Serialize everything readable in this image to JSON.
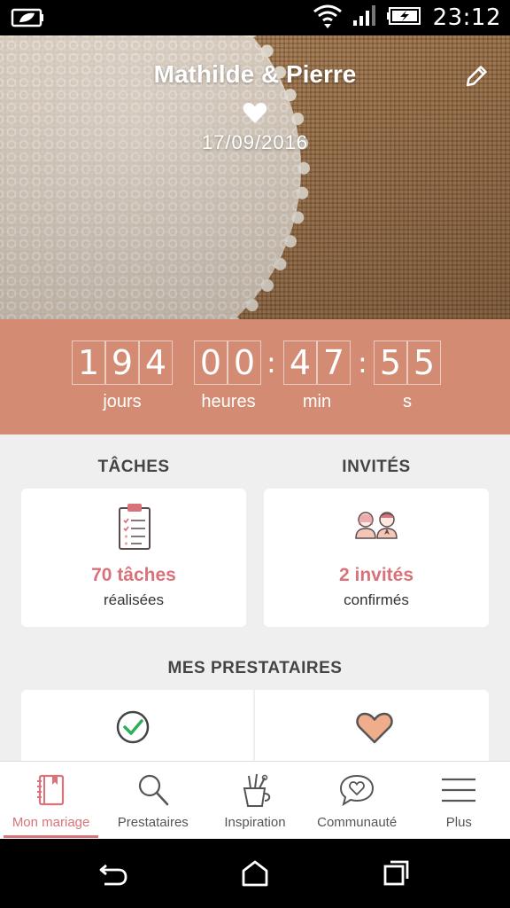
{
  "status_bar": {
    "time": "23:12"
  },
  "header": {
    "couple_names": "Mathilde & Pierre",
    "wedding_date": "17/09/2016"
  },
  "countdown": {
    "days_digits": [
      "1",
      "9",
      "4"
    ],
    "hours_digits": [
      "0",
      "0"
    ],
    "minutes_digits": [
      "4",
      "7"
    ],
    "seconds_digits": [
      "5",
      "5"
    ],
    "separator": ":",
    "days_label": "jours",
    "hours_label": "heures",
    "minutes_label": "min",
    "seconds_label": "s"
  },
  "tasks": {
    "title": "TÂCHES",
    "count": "70 tâches",
    "sub": "réalisées"
  },
  "guests": {
    "title": "INVITÉS",
    "count": "2 invités",
    "sub": "confirmés"
  },
  "vendors": {
    "title": "MES PRESTATAIRES"
  },
  "bottom_nav": {
    "items": [
      {
        "label": "Mon mariage",
        "icon": "notebook-icon"
      },
      {
        "label": "Prestataires",
        "icon": "search-icon"
      },
      {
        "label": "Inspiration",
        "icon": "brushes-icon"
      },
      {
        "label": "Communauté",
        "icon": "chat-heart-icon"
      },
      {
        "label": "Plus",
        "icon": "menu-icon"
      }
    ]
  },
  "colors": {
    "accent": "#d9727a",
    "countdown_bg": "#d38c73",
    "background": "#efefef"
  }
}
